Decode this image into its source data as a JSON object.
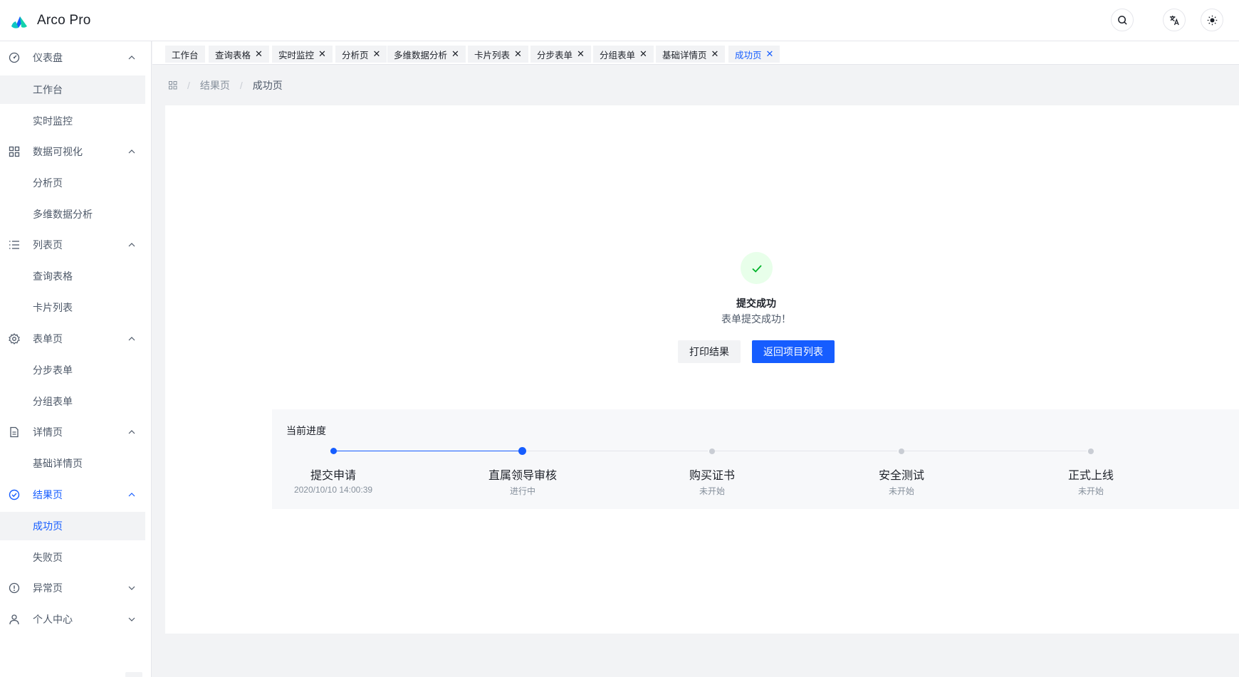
{
  "app": {
    "title": "Arco Pro"
  },
  "header": {
    "tools": [
      {
        "icon": "search-icon"
      },
      {
        "icon": "translate-icon"
      },
      {
        "icon": "theme-sun-icon"
      }
    ]
  },
  "sidebar": {
    "groups": [
      {
        "label": "仪表盘",
        "icon": "dashboard-icon",
        "expanded": true,
        "children": [
          "工作台",
          "实时监控"
        ]
      },
      {
        "label": "数据可视化",
        "icon": "grid-icon",
        "expanded": true,
        "children": [
          "分析页",
          "多维数据分析"
        ]
      },
      {
        "label": "列表页",
        "icon": "list-icon",
        "expanded": true,
        "children": [
          "查询表格",
          "卡片列表"
        ]
      },
      {
        "label": "表单页",
        "icon": "settings-icon",
        "expanded": true,
        "children": [
          "分步表单",
          "分组表单"
        ]
      },
      {
        "label": "详情页",
        "icon": "file-icon",
        "expanded": true,
        "children": [
          "基础详情页"
        ]
      },
      {
        "label": "结果页",
        "icon": "check-circle-icon",
        "expanded": true,
        "children": [
          "成功页",
          "失败页"
        ]
      },
      {
        "label": "异常页",
        "icon": "exclamation-circle-icon",
        "expanded": false,
        "children": []
      },
      {
        "label": "个人中心",
        "icon": "user-icon",
        "expanded": false,
        "children": []
      }
    ],
    "selected_item": "成功页"
  },
  "tabs": [
    "工作台",
    "查询表格",
    "实时监控",
    "分析页",
    "多维数据分析",
    "卡片列表",
    "分步表单",
    "分组表单",
    "基础详情页",
    "成功页"
  ],
  "active_tab": "成功页",
  "breadcrumb": {
    "home_icon": "apps-icon",
    "items": [
      "结果页",
      "成功页"
    ],
    "separator": "/"
  },
  "result": {
    "status_icon": "check-icon",
    "title": "提交成功",
    "subtitle": "表单提交成功！",
    "print_button": "打印结果",
    "back_button": "返回项目列表"
  },
  "progress": {
    "title": "当前进度",
    "steps": [
      {
        "title": "提交申请",
        "desc": "2020/10/10 14:00:39",
        "status": "done"
      },
      {
        "title": "直属领导审核",
        "desc": "进行中",
        "status": "process"
      },
      {
        "title": "购买证书",
        "desc": "未开始",
        "status": "wait"
      },
      {
        "title": "安全测试",
        "desc": "未开始",
        "status": "wait"
      },
      {
        "title": "正式上线",
        "desc": "未开始",
        "status": "wait"
      }
    ]
  },
  "colors": {
    "primary": "#165dff",
    "success": "#00b42a",
    "success_bg": "#e8ffea",
    "page_bg": "#f2f3f5"
  }
}
